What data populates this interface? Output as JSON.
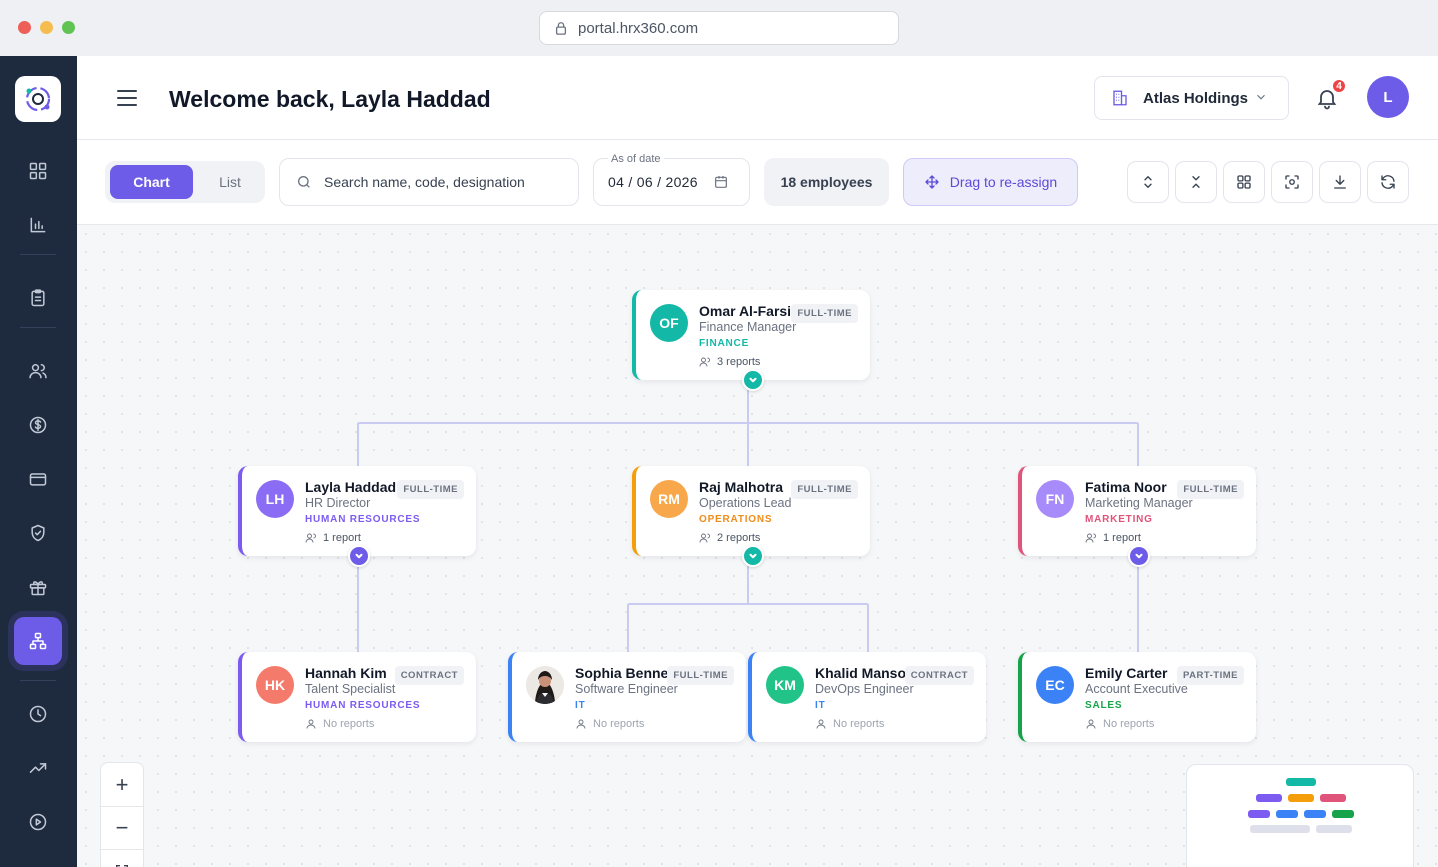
{
  "browser": {
    "url": "portal.hrx360.com"
  },
  "sidebar": {
    "items": [
      {
        "icon": "grid-icon"
      },
      {
        "icon": "bar-chart-icon"
      },
      {
        "icon": "clipboard-icon"
      },
      {
        "icon": "users-icon"
      },
      {
        "icon": "dollar-icon"
      },
      {
        "icon": "card-icon"
      },
      {
        "icon": "shield-icon"
      },
      {
        "icon": "gift-icon"
      },
      {
        "icon": "org-chart-icon",
        "active": true
      },
      {
        "icon": "clock-icon"
      },
      {
        "icon": "trending-icon"
      },
      {
        "icon": "play-icon"
      }
    ]
  },
  "header": {
    "welcome": "Welcome back, Layla Haddad",
    "organization": "Atlas Holdings",
    "notification_count": "4",
    "avatar_initial": "L"
  },
  "toolbar": {
    "view_chart": "Chart",
    "view_list": "List",
    "search_placeholder": "Search name, code, designation",
    "date_label": "As of date",
    "date_value": "04 / 06 / 2026",
    "employee_count": "18 employees",
    "drag_label": "Drag to re-assign"
  },
  "colors": {
    "accent": "#6c5ce7",
    "finance": "#14b8a6",
    "hr": "#7c5cf0",
    "operations": "#f59e0b",
    "marketing": "#e0537a",
    "it": "#3b82f6",
    "sales": "#16a34a"
  },
  "org": {
    "omar": {
      "initials": "OF",
      "name": "Omar Al-Farsi",
      "type": "FULL-TIME",
      "title": "Finance Manager",
      "dept": "FINANCE",
      "reports": "3 reports"
    },
    "layla": {
      "initials": "LH",
      "name": "Layla Haddad",
      "type": "FULL-TIME",
      "title": "HR Director",
      "dept": "HUMAN RESOURCES",
      "reports": "1 report"
    },
    "raj": {
      "initials": "RM",
      "name": "Raj Malhotra",
      "type": "FULL-TIME",
      "title": "Operations Lead",
      "dept": "OPERATIONS",
      "reports": "2 reports"
    },
    "fatima": {
      "initials": "FN",
      "name": "Fatima Noor",
      "type": "FULL-TIME",
      "title": "Marketing Manager",
      "dept": "MARKETING",
      "reports": "1 report"
    },
    "hannah": {
      "initials": "HK",
      "name": "Hannah Kim",
      "type": "CONTRACT",
      "title": "Talent Specialist",
      "dept": "HUMAN RESOURCES",
      "reports": "No reports"
    },
    "sophia": {
      "initials": "",
      "name": "Sophia Bennett",
      "type": "FULL-TIME",
      "title": "Software Engineer",
      "dept": "IT",
      "reports": "No reports"
    },
    "khalid": {
      "initials": "KM",
      "name": "Khalid Mansour",
      "type": "CONTRACT",
      "title": "DevOps Engineer",
      "dept": "IT",
      "reports": "No reports"
    },
    "emily": {
      "initials": "EC",
      "name": "Emily Carter",
      "type": "PART-TIME",
      "title": "Account Executive",
      "dept": "SALES",
      "reports": "No reports"
    }
  },
  "zoom": {
    "in": "+",
    "out": "−"
  }
}
